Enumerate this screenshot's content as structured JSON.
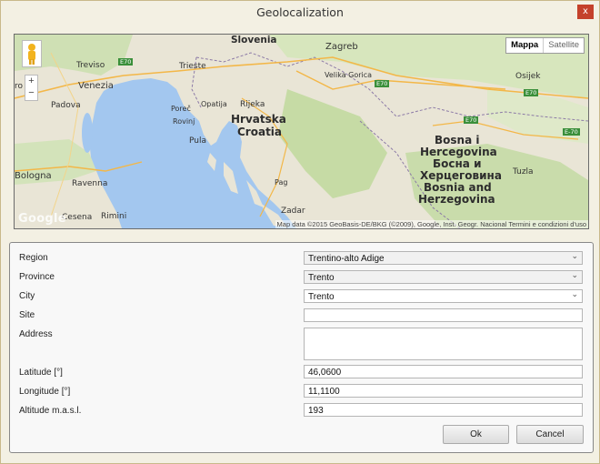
{
  "window": {
    "title": "Geolocalization",
    "close_label": "x"
  },
  "map": {
    "map_type": {
      "map": "Mappa",
      "satellite": "Satellite"
    },
    "zoom_in": "+",
    "zoom_out": "−",
    "logo": "Google",
    "credit": "Map data ©2015 GeoBasis-DE/BKG (©2009), Google, Inst. Geogr. Nacional    Termini e condizioni d'uso",
    "places": {
      "slovenia": "Slovenia",
      "zagreb": "Zagreb",
      "treviso": "Treviso",
      "trieste": "Trieste",
      "velika_gorica": "Velika Gorica",
      "osijek": "Osijek",
      "venezia": "Venezia",
      "rijeka": "Rijeka",
      "opatija": "Opatija",
      "padova": "Padova",
      "porec": "Poreč",
      "rovinj": "Rovinj",
      "hrvatska": "Hrvatska",
      "croatia": "Croatia",
      "pula": "Pula",
      "bih1": "Bosna i",
      "bih2": "Hercegovina",
      "bih3": "Босна и",
      "bih4": "Херцеговина",
      "bih5": "Bosnia and",
      "bih6": "Herzegovina",
      "tuzla": "Tuzla",
      "bologna": "Bologna",
      "ravenna": "Ravenna",
      "pag": "Pag",
      "cesena": "Cesena",
      "rimini": "Rimini",
      "zadar": "Zadar",
      "ro": "ro"
    },
    "roads": {
      "e70a": "E70",
      "e70b": "E70",
      "e70c": "E70",
      "e70d": "E70",
      "e70e": "E-70"
    }
  },
  "form": {
    "region": {
      "label": "Region",
      "value": "Trentino-alto Adige"
    },
    "province": {
      "label": "Province",
      "value": "Trento"
    },
    "city": {
      "label": "City",
      "value": "Trento"
    },
    "site": {
      "label": "Site",
      "value": ""
    },
    "address": {
      "label": "Address",
      "value": ""
    },
    "latitude": {
      "label": "Latitude [°]",
      "value": "46,0600"
    },
    "longitude": {
      "label": "Longitude [°]",
      "value": "11,1100"
    },
    "altitude": {
      "label": "Altitude m.a.s.l.",
      "value": "193"
    }
  },
  "buttons": {
    "ok": "Ok",
    "cancel": "Cancel"
  }
}
